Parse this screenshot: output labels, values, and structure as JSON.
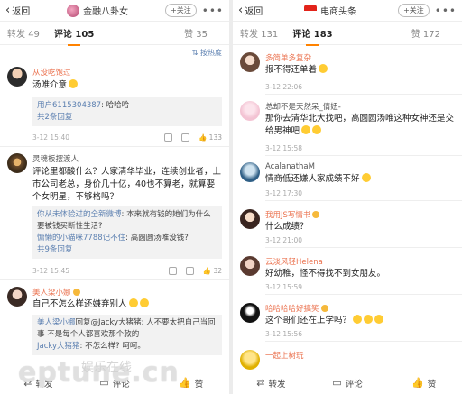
{
  "left": {
    "nav": {
      "back": "返回",
      "title": "金融八卦女",
      "follow": "+关注",
      "more": "•••"
    },
    "tabs": {
      "repost_label": "转发",
      "repost": "49",
      "comment_label": "评论",
      "comment": "105",
      "like_label": "赞",
      "like": "35"
    },
    "sort": "按热度",
    "comments": [
      {
        "user": "从没吃饱过",
        "text": "汤唯介意",
        "reply_lines": [
          {
            "who": "用户6115304387",
            "text": ": 哈哈哈"
          }
        ],
        "reply_more": "共2条回复",
        "date": "3-12 15:40",
        "likes": "133"
      },
      {
        "user": "灵魂板摆渡人",
        "text": "评论里都酸什么？人家清华毕业，连续创业者，上市公司老总，身价几十亿，40也不算老，就算娶个女明星，不够格吗？",
        "reply_lines": [
          {
            "who": "你从未体验过的全新微博",
            "text": ": 本来就有钱的她们为什么要被钱买断性生活?"
          },
          {
            "who": "慵懒的小猫咪7788记不住",
            "text": ": 高圆圆汤唯没钱?"
          }
        ],
        "reply_more": "共9条回复",
        "date": "3-12 15:45",
        "likes": "32"
      },
      {
        "user": "美人梁小娜",
        "text": "自己不怎么样还嫌弃别人",
        "reply_lines": [
          {
            "who": "美人梁小娜",
            "text": "回复@Jacky大猪猪: 人不要太把自己当回事 不是每个人都喜欢那个款的"
          },
          {
            "who": "Jacky大猪猪",
            "text": ": 不怎么样? 呵呵。"
          }
        ]
      }
    ],
    "bottom": {
      "repost": "转发",
      "comment": "评论",
      "like": "赞"
    }
  },
  "right": {
    "nav": {
      "back": "返回",
      "title": "电商头条",
      "follow": "+关注",
      "more": "•••"
    },
    "tabs": {
      "repost_label": "转发",
      "repost": "131",
      "comment_label": "评论",
      "comment": "183",
      "like_label": "赞",
      "like": "172"
    },
    "comments": [
      {
        "user": "多简单多复杂",
        "text": "报不得还单着",
        "date": "3-12 22:06",
        "likes": ""
      },
      {
        "user": "总却不是天然呆_倩妞-",
        "text": "那你去清华北大找吧，高圆圆汤唯这种女神还是交给男神吧",
        "date": "3-12 15:58",
        "likes": ""
      },
      {
        "user": "AcalanathaM",
        "text": "情商低还嫌人家成绩不好",
        "date": "3-12 17:30",
        "likes": ""
      },
      {
        "user": "我用JS写情书",
        "text": "什么成绩？",
        "date": "3-12 21:00",
        "likes": ""
      },
      {
        "user": "云淡风轻Helena",
        "text": "好幼稚，怪不得找不到女朋友。",
        "date": "3-12 15:59",
        "likes": ""
      },
      {
        "user": "哈哈哈哈好搞笑",
        "text": "这个哥们还在上学吗？",
        "date": "3-12 15:56",
        "likes": ""
      },
      {
        "user": "一起上树玩",
        "text": "",
        "date": "",
        "likes": ""
      }
    ],
    "bottom": {
      "repost": "转发",
      "comment": "评论",
      "like": "赞"
    }
  },
  "watermark": "eptune.cn",
  "watermark_cn": "娱乐在线"
}
